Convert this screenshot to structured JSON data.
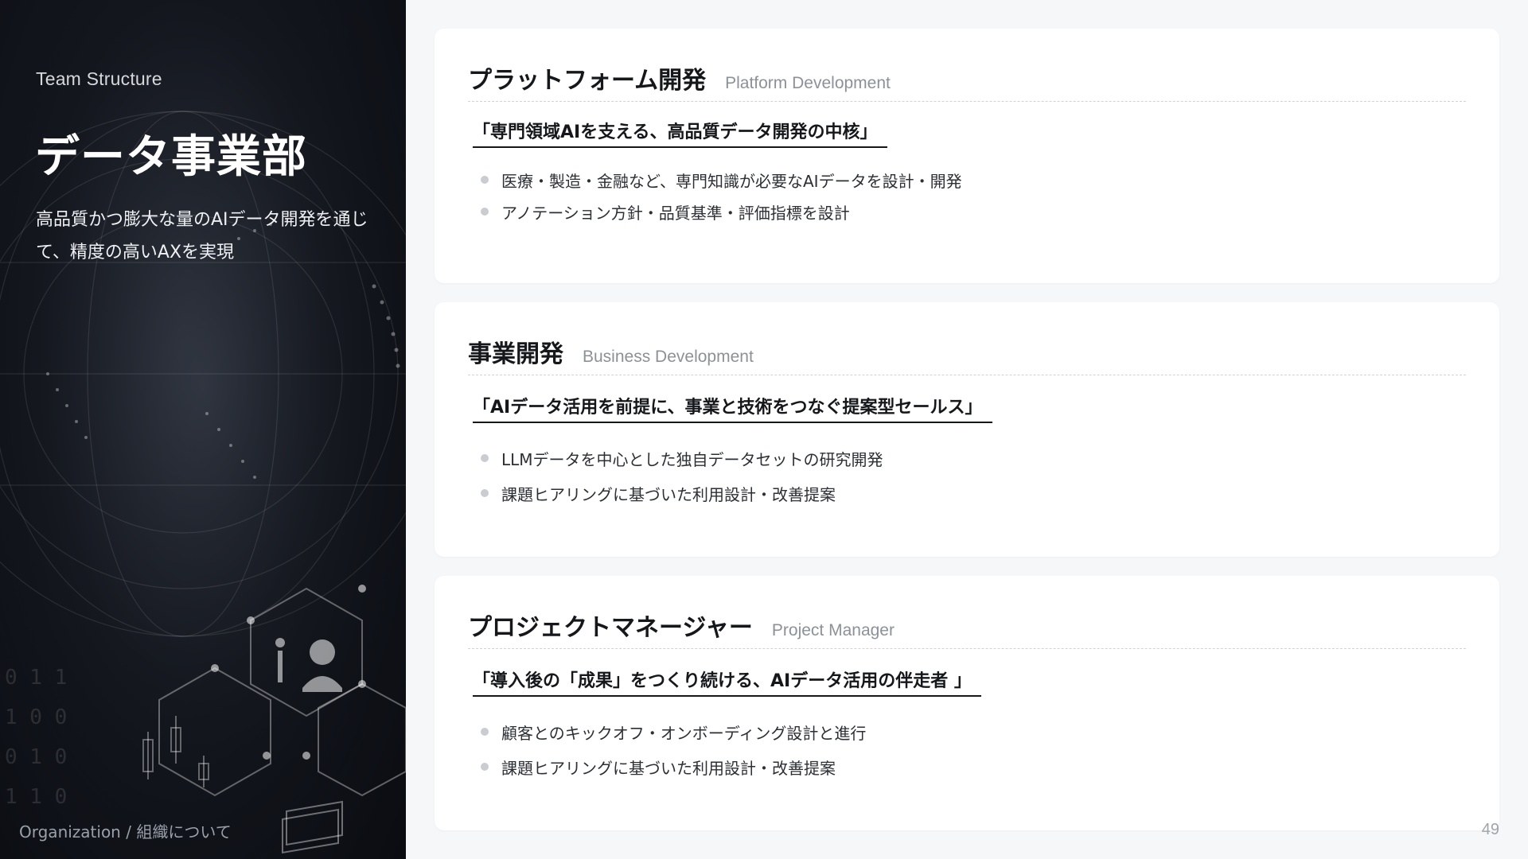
{
  "left": {
    "eyebrow": "Team Structure",
    "title": "データ事業部",
    "lead": "高品質かつ膨大な量のAIデータ開発を通じて、精度の高いAXを実現",
    "footer": "Organization / 組織について"
  },
  "cards": [
    {
      "title": "プラットフォーム開発",
      "subtitle": "Platform Development",
      "tagline": "「専門領域AIを支える、高品質データ開発の中核」",
      "bullets": [
        "医療・製造・金融など、専門知識が必要なAIデータを設計・開発",
        "アノテーション方針・品質基準・評価指標を設計"
      ]
    },
    {
      "title": "事業開発",
      "subtitle": "Business Development",
      "tagline": "「AIデータ活用を前提に、事業と技術をつなぐ提案型セールス」",
      "bullets": [
        "LLMデータを中心とした独自データセットの研究開発",
        "課題ヒアリングに基づいた利用設計・改善提案"
      ]
    },
    {
      "title": "プロジェクトマネージャー",
      "subtitle": "Project Manager",
      "tagline": "「導入後の「成果」をつくり続ける、AIデータ活用の伴走者 」",
      "bullets": [
        "顧客とのキックオフ・オンボーディング設計と進行",
        "課題ヒアリングに基づいた利用設計・改善提案"
      ]
    }
  ],
  "page_number": "49",
  "colors": {
    "panel_dark": "#0a0c11",
    "text_dark": "#15171b",
    "muted": "#8c9199",
    "bullet_dot": "#c9ccd1",
    "page_bg": "#f6f7f9"
  }
}
